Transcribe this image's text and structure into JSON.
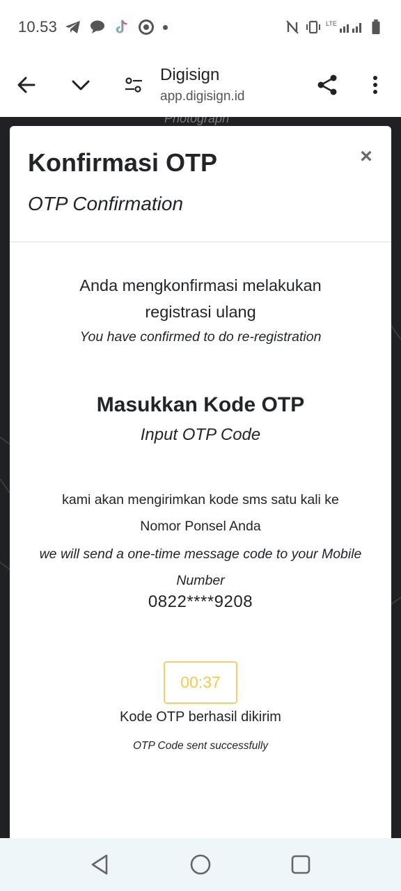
{
  "status_bar": {
    "time": "10.53",
    "icons": [
      "telegram-icon",
      "chat-bubble-icon",
      "tiktok-icon",
      "record-icon",
      "nfc-icon",
      "vibrate-icon",
      "lte-signal-icon",
      "battery-icon"
    ]
  },
  "browser": {
    "site_title": "Digisign",
    "site_url": "app.digisign.id"
  },
  "background": {
    "partial_text": "Photograph"
  },
  "modal": {
    "title": "Konfirmasi OTP",
    "subtitle": "OTP Confirmation",
    "close_label": "×",
    "confirm_text": "Anda mengkonfirmasi melakukan registrasi ulang",
    "confirm_text_en": "You have confirmed to do re-registration",
    "otp_heading": "Masukkan Kode OTP",
    "otp_heading_en": "Input OTP Code",
    "sms_text": "kami akan mengirimkan kode sms satu kali ke Nomor Ponsel Anda",
    "sms_text_en": "we will send a one-time message code to your Mobile Number",
    "phone_number": "0822****9208",
    "timer": "00:37",
    "sent_text": "Kode OTP berhasil dikirim",
    "sent_text_en": "OTP Code sent successfully"
  },
  "colors": {
    "timer_accent": "#f2c94c",
    "backdrop": "#202124",
    "nav_bar": "#eef6f9"
  }
}
